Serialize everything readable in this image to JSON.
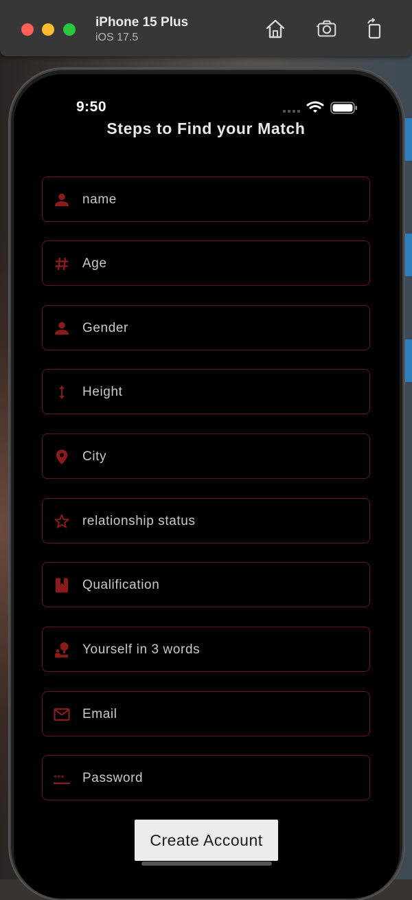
{
  "window": {
    "device_name": "iPhone 15 Plus",
    "os_version": "iOS 17.5",
    "toolbar_icons": [
      "home-icon",
      "screenshot-icon",
      "rotate-icon"
    ]
  },
  "status_bar": {
    "time": "9:50",
    "icons": [
      "cellular-icon",
      "wifi-icon",
      "battery-icon"
    ]
  },
  "page": {
    "title": "Steps to Find your Match"
  },
  "form": {
    "fields": [
      {
        "label": "name",
        "icon": "person-icon"
      },
      {
        "label": "Age",
        "icon": "hash-icon"
      },
      {
        "label": "Gender",
        "icon": "person-icon"
      },
      {
        "label": "Height",
        "icon": "height-arrow-icon"
      },
      {
        "label": "City",
        "icon": "location-pin-icon"
      },
      {
        "label": "relationship status",
        "icon": "star-outline-icon"
      },
      {
        "label": "Qualification",
        "icon": "book-icon"
      },
      {
        "label": "Yourself in 3 words",
        "icon": "person-idea-icon"
      },
      {
        "label": "Email",
        "icon": "mail-icon"
      },
      {
        "label": "Password",
        "icon": "password-icon"
      }
    ],
    "submit_label": "Create Account"
  },
  "colors": {
    "accent": "#8b1a1a",
    "field_border": "#6a1414",
    "screen_background": "#000000",
    "button_background": "#ececec"
  }
}
